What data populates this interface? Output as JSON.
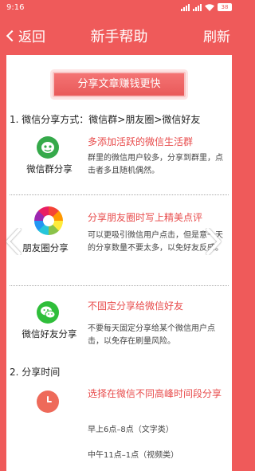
{
  "status_bar": {
    "time": "9:16",
    "battery": "38"
  },
  "nav": {
    "back_label": "返回",
    "title": "新手帮助",
    "refresh_label": "刷新"
  },
  "banner": {
    "text": "分享文章赚钱更快"
  },
  "section1": {
    "title": "1. 微信分享方式：微信群>朋友圈>微信好友",
    "entries": [
      {
        "icon": "wechat-group-icon",
        "label": "微信群分享",
        "heading": "多添加活跃的微信生活群",
        "desc": "群里的微信用户较多，分享到群里，点击者多且随机偶然。"
      },
      {
        "icon": "moments-aperture-icon",
        "label": "朋友圈分享",
        "heading": "分享朋友圈时写上精美点评",
        "desc": "可以更吸引微信用户点击，但是意一天的分享数量不要太多，以免好友反感。"
      },
      {
        "icon": "wechat-icon",
        "label": "微信好友分享",
        "heading": "不固定分享给微信好友",
        "desc": "不要每天固定分享给某个微信用户点击，以免存在刷量风险。"
      }
    ]
  },
  "section2": {
    "title": "2. 分享时间",
    "entry": {
      "icon": "clock-icon",
      "heading": "选择在微信不同高峰时间段分享",
      "lines": [
        "早上6点–8点（文字类）",
        "中午11点–1点（视频类）"
      ]
    }
  },
  "colors": {
    "theme": "#ef5a5a",
    "heading": "#e84c4c",
    "wechat_green": "#35a94a"
  }
}
